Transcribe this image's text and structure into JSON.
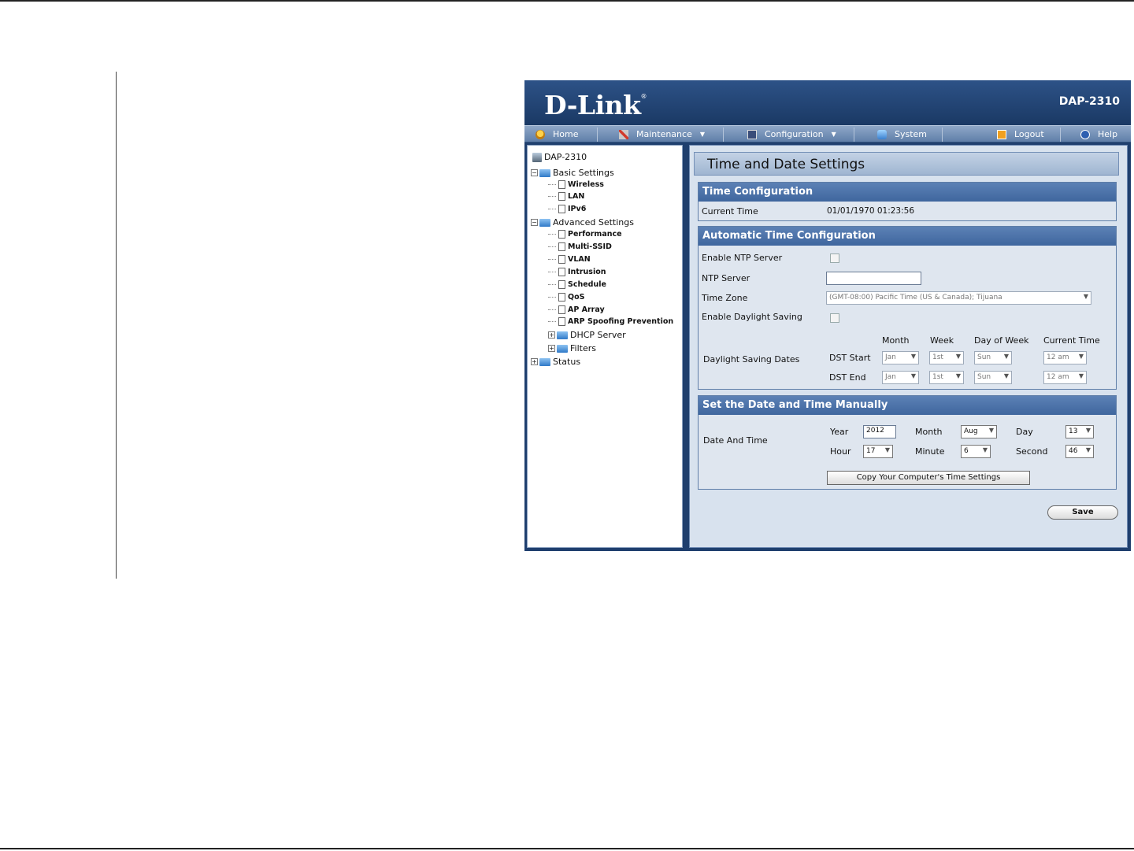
{
  "header": {
    "logo": "D-Link",
    "logo_mark": "®",
    "model": "DAP-2310"
  },
  "menu": [
    {
      "label": "Home",
      "icon": "home-icon"
    },
    {
      "label": "Maintenance",
      "icon": "tools-icon",
      "dropdown": "▼"
    },
    {
      "label": "Configuration",
      "icon": "configuration-icon",
      "dropdown": "▼"
    },
    {
      "label": "System",
      "icon": "system-icon"
    },
    {
      "label": "Logout",
      "icon": "logout-icon"
    },
    {
      "label": "Help",
      "icon": "help-icon"
    }
  ],
  "tree": {
    "root": "DAP-2310",
    "basic": {
      "label": "Basic Settings",
      "items": [
        "Wireless",
        "LAN",
        "IPv6"
      ]
    },
    "advanced": {
      "label": "Advanced Settings",
      "items": [
        "Performance",
        "Multi-SSID",
        "VLAN",
        "Intrusion",
        "Schedule",
        "QoS",
        "AP Array",
        "ARP Spoofing Prevention"
      ]
    },
    "dhcp": "DHCP Server",
    "filters": "Filters",
    "status": "Status"
  },
  "page": {
    "title": "Time and Date Settings"
  },
  "time_config": {
    "heading": "Time Configuration",
    "current_time_label": "Current Time",
    "current_time_value": "01/01/1970 01:23:56"
  },
  "auto_config": {
    "heading": "Automatic Time Configuration",
    "ntp_enable_label": "Enable NTP Server",
    "ntp_server_label": "NTP Server",
    "ntp_server_value": "",
    "timezone_label": "Time Zone",
    "timezone_value": "(GMT-08:00) Pacific Time (US & Canada); Tijuana",
    "dst_enable_label": "Enable Daylight Saving",
    "dst_dates_label": "Daylight Saving Dates",
    "columns": [
      "Month",
      "Week",
      "Day of Week",
      "Current Time"
    ],
    "dst_start_label": "DST Start",
    "dst_end_label": "DST End",
    "dst_start": [
      "Jan",
      "1st",
      "Sun",
      "12 am"
    ],
    "dst_end": [
      "Jan",
      "1st",
      "Sun",
      "12 am"
    ]
  },
  "manual": {
    "heading": "Set the Date and Time Manually",
    "date_time_label": "Date And Time",
    "year_label": "Year",
    "year_value": "2012",
    "month_label": "Month",
    "month_value": "Aug",
    "day_label": "Day",
    "day_value": "13",
    "hour_label": "Hour",
    "hour_value": "17",
    "minute_label": "Minute",
    "minute_value": "6",
    "second_label": "Second",
    "second_value": "46",
    "copy_button": "Copy Your Computer's Time Settings"
  },
  "save_button": "Save",
  "arrow": "▼"
}
